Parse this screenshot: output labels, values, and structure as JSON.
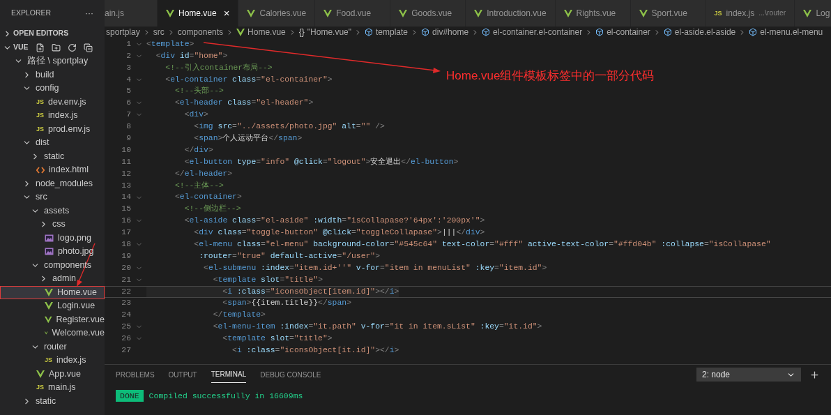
{
  "sidebar": {
    "title": "EXPLORER",
    "more": "···",
    "sections": [
      {
        "label": "OPEN EDITORS",
        "expanded": false
      },
      {
        "label": "VUE",
        "expanded": true
      }
    ],
    "tree": [
      {
        "kind": "folder",
        "label": "路径 \\ sportplay",
        "expanded": true,
        "selected": false,
        "children": [
          {
            "kind": "folder",
            "label": "build",
            "expanded": false,
            "selected": false
          },
          {
            "kind": "folder",
            "label": "config",
            "expanded": true,
            "selected": false,
            "children": [
              {
                "kind": "js",
                "icon": "JS",
                "label": "dev.env.js",
                "selected": false
              },
              {
                "kind": "js",
                "icon": "JS",
                "label": "index.js",
                "selected": false
              },
              {
                "kind": "js",
                "icon": "JS",
                "label": "prod.env.js",
                "selected": false
              }
            ]
          },
          {
            "kind": "folder",
            "label": "dist",
            "expanded": true,
            "selected": false,
            "children": [
              {
                "kind": "folder",
                "label": "static",
                "expanded": false,
                "selected": false
              },
              {
                "kind": "html",
                "label": "index.html",
                "selected": false
              }
            ]
          },
          {
            "kind": "folder",
            "label": "node_modules",
            "expanded": false,
            "selected": false
          },
          {
            "kind": "folder",
            "label": "src",
            "expanded": true,
            "selected": false,
            "children": [
              {
                "kind": "folder",
                "label": "assets",
                "expanded": true,
                "selected": false,
                "children": [
                  {
                    "kind": "folder",
                    "label": "css",
                    "expanded": false,
                    "selected": false
                  },
                  {
                    "kind": "image",
                    "label": "logo.png",
                    "selected": false
                  },
                  {
                    "kind": "image",
                    "label": "photo.jpg",
                    "selected": false
                  }
                ]
              },
              {
                "kind": "folder",
                "label": "components",
                "expanded": true,
                "selected": false,
                "children": [
                  {
                    "kind": "folder",
                    "label": "admin",
                    "expanded": false,
                    "selected": false
                  },
                  {
                    "kind": "vue",
                    "label": "Home.vue",
                    "selected": true
                  },
                  {
                    "kind": "vue",
                    "label": "Login.vue",
                    "selected": false
                  },
                  {
                    "kind": "vue",
                    "label": "Register.vue",
                    "selected": false
                  },
                  {
                    "kind": "vue",
                    "label": "Welcome.vue",
                    "selected": false
                  }
                ]
              },
              {
                "kind": "folder",
                "label": "router",
                "expanded": true,
                "selected": false,
                "children": [
                  {
                    "kind": "js",
                    "icon": "JS",
                    "label": "index.js",
                    "selected": false
                  }
                ]
              },
              {
                "kind": "vue",
                "label": "App.vue",
                "selected": false
              },
              {
                "kind": "js",
                "icon": "JS",
                "label": "main.js",
                "selected": false
              }
            ]
          },
          {
            "kind": "folder",
            "label": "static",
            "expanded": false,
            "selected": false
          }
        ]
      }
    ]
  },
  "tabs": [
    {
      "label": "ain.js",
      "selected": false
    },
    {
      "kind": "vue",
      "label": "Home.vue",
      "selected": true,
      "close": "×"
    },
    {
      "kind": "vue",
      "label": "Calories.vue",
      "selected": false
    },
    {
      "kind": "vue",
      "label": "Food.vue",
      "selected": false
    },
    {
      "kind": "vue",
      "label": "Goods.vue",
      "selected": false
    },
    {
      "kind": "vue",
      "label": "Introduction.vue",
      "selected": false
    },
    {
      "kind": "vue",
      "label": "Rights.vue",
      "selected": false
    },
    {
      "kind": "vue",
      "label": "Sport.vue",
      "selected": false
    },
    {
      "kind": "js",
      "icon": "JS",
      "label": "index.js",
      "hint": "...\\router",
      "selected": false
    },
    {
      "kind": "vue",
      "label": "Log",
      "selected": false
    }
  ],
  "breadcrumbs": [
    {
      "kind": "folder",
      "label": "sportplay"
    },
    {
      "kind": "folder",
      "label": "src"
    },
    {
      "kind": "folder",
      "label": "components"
    },
    {
      "kind": "vue",
      "label": "Home.vue"
    },
    {
      "kind": "object",
      "icon": "{}",
      "label": "\"Home.vue\""
    },
    {
      "kind": "element",
      "label": "template"
    },
    {
      "kind": "element",
      "label": "div#home"
    },
    {
      "kind": "element",
      "label": "el-container.el-container"
    },
    {
      "kind": "element",
      "label": "el-container"
    },
    {
      "kind": "element",
      "label": "el-aside.el-aside"
    },
    {
      "kind": "element",
      "label": "el-menu.el-menu"
    }
  ],
  "code": [
    {
      "n": "1",
      "fold": true,
      "current": false,
      "tokens": [
        {
          "kind": "p",
          "text": "<"
        },
        {
          "kind": "t",
          "text": "template"
        },
        {
          "kind": "p",
          "text": ">"
        }
      ]
    },
    {
      "n": "2",
      "fold": true,
      "current": false,
      "tokens": [
        {
          "kind": "p",
          "text": "  <"
        },
        {
          "kind": "t",
          "text": "div"
        },
        {
          "kind": "a",
          "text": " id"
        },
        {
          "kind": "p",
          "text": "="
        },
        {
          "kind": "s",
          "text": "\"home\""
        },
        {
          "kind": "p",
          "text": ">"
        }
      ]
    },
    {
      "n": "3",
      "fold": false,
      "current": false,
      "tokens": [
        {
          "kind": "c",
          "text": "    <!--引入container布局-->"
        }
      ]
    },
    {
      "n": "4",
      "fold": true,
      "current": false,
      "tokens": [
        {
          "kind": "p",
          "text": "    <"
        },
        {
          "kind": "t",
          "text": "el-container"
        },
        {
          "kind": "a",
          "text": " class"
        },
        {
          "kind": "p",
          "text": "="
        },
        {
          "kind": "s",
          "text": "\"el-container\""
        },
        {
          "kind": "p",
          "text": ">"
        }
      ]
    },
    {
      "n": "5",
      "fold": false,
      "current": false,
      "tokens": [
        {
          "kind": "c",
          "text": "      <!--头部-->"
        }
      ]
    },
    {
      "n": "6",
      "fold": true,
      "current": false,
      "tokens": [
        {
          "kind": "p",
          "text": "      <"
        },
        {
          "kind": "t",
          "text": "el-header"
        },
        {
          "kind": "a",
          "text": " class"
        },
        {
          "kind": "p",
          "text": "="
        },
        {
          "kind": "s",
          "text": "\"el-header\""
        },
        {
          "kind": "p",
          "text": ">"
        }
      ]
    },
    {
      "n": "7",
      "fold": true,
      "current": false,
      "tokens": [
        {
          "kind": "p",
          "text": "        <"
        },
        {
          "kind": "t",
          "text": "div"
        },
        {
          "kind": "p",
          "text": ">"
        }
      ]
    },
    {
      "n": "8",
      "fold": false,
      "current": false,
      "tokens": [
        {
          "kind": "p",
          "text": "          <"
        },
        {
          "kind": "t",
          "text": "img"
        },
        {
          "kind": "a",
          "text": " src"
        },
        {
          "kind": "p",
          "text": "="
        },
        {
          "kind": "s",
          "text": "\"../assets/photo.jpg\""
        },
        {
          "kind": "a",
          "text": " alt"
        },
        {
          "kind": "p",
          "text": "="
        },
        {
          "kind": "s",
          "text": "\"\""
        },
        {
          "kind": "p",
          "text": " />"
        }
      ]
    },
    {
      "n": "9",
      "fold": false,
      "current": false,
      "tokens": [
        {
          "kind": "p",
          "text": "          <"
        },
        {
          "kind": "t",
          "text": "span"
        },
        {
          "kind": "p",
          "text": ">"
        },
        {
          "kind": "x",
          "text": "个人运动平台"
        },
        {
          "kind": "p",
          "text": "</"
        },
        {
          "kind": "t",
          "text": "span"
        },
        {
          "kind": "p",
          "text": ">"
        }
      ]
    },
    {
      "n": "10",
      "fold": false,
      "current": false,
      "tokens": [
        {
          "kind": "p",
          "text": "        </"
        },
        {
          "kind": "t",
          "text": "div"
        },
        {
          "kind": "p",
          "text": ">"
        }
      ]
    },
    {
      "n": "11",
      "fold": false,
      "current": false,
      "tokens": [
        {
          "kind": "p",
          "text": "        <"
        },
        {
          "kind": "t",
          "text": "el-button"
        },
        {
          "kind": "a",
          "text": " type"
        },
        {
          "kind": "p",
          "text": "="
        },
        {
          "kind": "s",
          "text": "\"info\""
        },
        {
          "kind": "a",
          "text": " @click"
        },
        {
          "kind": "p",
          "text": "="
        },
        {
          "kind": "s",
          "text": "\"logout\""
        },
        {
          "kind": "p",
          "text": ">"
        },
        {
          "kind": "x",
          "text": "安全退出"
        },
        {
          "kind": "p",
          "text": "</"
        },
        {
          "kind": "t",
          "text": "el-button"
        },
        {
          "kind": "p",
          "text": ">"
        }
      ]
    },
    {
      "n": "12",
      "fold": false,
      "current": false,
      "tokens": [
        {
          "kind": "p",
          "text": "      </"
        },
        {
          "kind": "t",
          "text": "el-header"
        },
        {
          "kind": "p",
          "text": ">"
        }
      ]
    },
    {
      "n": "13",
      "fold": false,
      "current": false,
      "tokens": [
        {
          "kind": "c",
          "text": "      <!--主体-->"
        }
      ]
    },
    {
      "n": "14",
      "fold": true,
      "current": false,
      "tokens": [
        {
          "kind": "p",
          "text": "      <"
        },
        {
          "kind": "t",
          "text": "el-container"
        },
        {
          "kind": "p",
          "text": ">"
        }
      ]
    },
    {
      "n": "15",
      "fold": false,
      "current": false,
      "tokens": [
        {
          "kind": "c",
          "text": "        <!--侧边栏-->"
        }
      ]
    },
    {
      "n": "16",
      "fold": true,
      "current": false,
      "tokens": [
        {
          "kind": "p",
          "text": "        <"
        },
        {
          "kind": "t",
          "text": "el-aside"
        },
        {
          "kind": "a",
          "text": " class"
        },
        {
          "kind": "p",
          "text": "="
        },
        {
          "kind": "s",
          "text": "\"el-aside\""
        },
        {
          "kind": "a",
          "text": " :width"
        },
        {
          "kind": "p",
          "text": "="
        },
        {
          "kind": "s",
          "text": "\"isCollapase?'64px':'200px'\""
        },
        {
          "kind": "p",
          "text": ">"
        }
      ]
    },
    {
      "n": "17",
      "fold": false,
      "current": false,
      "tokens": [
        {
          "kind": "p",
          "text": "          <"
        },
        {
          "kind": "t",
          "text": "div"
        },
        {
          "kind": "a",
          "text": " class"
        },
        {
          "kind": "p",
          "text": "="
        },
        {
          "kind": "s",
          "text": "\"toggle-button\""
        },
        {
          "kind": "a",
          "text": " @click"
        },
        {
          "kind": "p",
          "text": "="
        },
        {
          "kind": "s",
          "text": "\"toggleCollapase\""
        },
        {
          "kind": "p",
          "text": ">"
        },
        {
          "kind": "x",
          "text": "|||"
        },
        {
          "kind": "p",
          "text": "</"
        },
        {
          "kind": "t",
          "text": "div"
        },
        {
          "kind": "p",
          "text": ">"
        }
      ]
    },
    {
      "n": "18",
      "fold": true,
      "current": false,
      "tokens": [
        {
          "kind": "p",
          "text": "          <"
        },
        {
          "kind": "t",
          "text": "el-menu"
        },
        {
          "kind": "a",
          "text": " class"
        },
        {
          "kind": "p",
          "text": "="
        },
        {
          "kind": "s",
          "text": "\"el-menu\""
        },
        {
          "kind": "a",
          "text": " background-color"
        },
        {
          "kind": "p",
          "text": "="
        },
        {
          "kind": "s",
          "text": "\"#545c64\""
        },
        {
          "kind": "a",
          "text": " text-color"
        },
        {
          "kind": "p",
          "text": "="
        },
        {
          "kind": "s",
          "text": "\"#fff\""
        },
        {
          "kind": "a",
          "text": " active-text-color"
        },
        {
          "kind": "p",
          "text": "="
        },
        {
          "kind": "s",
          "text": "\"#ffd04b\""
        },
        {
          "kind": "a",
          "text": " :collapse"
        },
        {
          "kind": "p",
          "text": "="
        },
        {
          "kind": "s",
          "text": "\"isCollapase\""
        }
      ]
    },
    {
      "n": "19",
      "fold": false,
      "current": false,
      "tokens": [
        {
          "kind": "a",
          "text": "           :router"
        },
        {
          "kind": "p",
          "text": "="
        },
        {
          "kind": "s",
          "text": "\"true\""
        },
        {
          "kind": "a",
          "text": " default-active"
        },
        {
          "kind": "p",
          "text": "="
        },
        {
          "kind": "s",
          "text": "\"/user\""
        },
        {
          "kind": "p",
          "text": ">"
        }
      ]
    },
    {
      "n": "20",
      "fold": true,
      "current": false,
      "tokens": [
        {
          "kind": "p",
          "text": "            <"
        },
        {
          "kind": "t",
          "text": "el-submenu"
        },
        {
          "kind": "a",
          "text": " :index"
        },
        {
          "kind": "p",
          "text": "="
        },
        {
          "kind": "s",
          "text": "\"item.id+''\""
        },
        {
          "kind": "a",
          "text": " v-for"
        },
        {
          "kind": "p",
          "text": "="
        },
        {
          "kind": "s",
          "text": "\"item in menuList\""
        },
        {
          "kind": "a",
          "text": " :key"
        },
        {
          "kind": "p",
          "text": "="
        },
        {
          "kind": "s",
          "text": "\"item.id\""
        },
        {
          "kind": "p",
          "text": ">"
        }
      ]
    },
    {
      "n": "21",
      "fold": true,
      "current": false,
      "tokens": [
        {
          "kind": "p",
          "text": "              <"
        },
        {
          "kind": "t",
          "text": "template"
        },
        {
          "kind": "a",
          "text": " slot"
        },
        {
          "kind": "p",
          "text": "="
        },
        {
          "kind": "s",
          "text": "\"title\""
        },
        {
          "kind": "p",
          "text": ">"
        }
      ]
    },
    {
      "n": "22",
      "fold": false,
      "current": true,
      "tokens": [
        {
          "kind": "p",
          "text": "                <"
        },
        {
          "kind": "t",
          "text": "i"
        },
        {
          "kind": "a",
          "text": " :class"
        },
        {
          "kind": "p",
          "text": "="
        },
        {
          "kind": "s",
          "text": "\"iconsObject[item.id]\""
        },
        {
          "kind": "p",
          "text": "></"
        },
        {
          "kind": "t",
          "text": "i"
        },
        {
          "kind": "p",
          "text": ">"
        }
      ]
    },
    {
      "n": "23",
      "fold": false,
      "current": false,
      "tokens": [
        {
          "kind": "p",
          "text": "                <"
        },
        {
          "kind": "t",
          "text": "span"
        },
        {
          "kind": "p",
          "text": ">"
        },
        {
          "kind": "x",
          "text": "{{item.title}}"
        },
        {
          "kind": "p",
          "text": "</"
        },
        {
          "kind": "t",
          "text": "span"
        },
        {
          "kind": "p",
          "text": ">"
        }
      ]
    },
    {
      "n": "24",
      "fold": false,
      "current": false,
      "tokens": [
        {
          "kind": "p",
          "text": "              </"
        },
        {
          "kind": "t",
          "text": "template"
        },
        {
          "kind": "p",
          "text": ">"
        }
      ]
    },
    {
      "n": "25",
      "fold": true,
      "current": false,
      "tokens": [
        {
          "kind": "p",
          "text": "              <"
        },
        {
          "kind": "t",
          "text": "el-menu-item"
        },
        {
          "kind": "a",
          "text": " :index"
        },
        {
          "kind": "p",
          "text": "="
        },
        {
          "kind": "s",
          "text": "\"it.path\""
        },
        {
          "kind": "a",
          "text": " v-for"
        },
        {
          "kind": "p",
          "text": "="
        },
        {
          "kind": "s",
          "text": "\"it in item.sList\""
        },
        {
          "kind": "a",
          "text": " :key"
        },
        {
          "kind": "p",
          "text": "="
        },
        {
          "kind": "s",
          "text": "\"it.id\""
        },
        {
          "kind": "p",
          "text": ">"
        }
      ]
    },
    {
      "n": "26",
      "fold": true,
      "current": false,
      "tokens": [
        {
          "kind": "p",
          "text": "                <"
        },
        {
          "kind": "t",
          "text": "template"
        },
        {
          "kind": "a",
          "text": " slot"
        },
        {
          "kind": "p",
          "text": "="
        },
        {
          "kind": "s",
          "text": "\"title\""
        },
        {
          "kind": "p",
          "text": ">"
        }
      ]
    },
    {
      "n": "27",
      "fold": false,
      "current": false,
      "tokens": [
        {
          "kind": "p",
          "text": "                  <"
        },
        {
          "kind": "t",
          "text": "i"
        },
        {
          "kind": "a",
          "text": " :class"
        },
        {
          "kind": "p",
          "text": "="
        },
        {
          "kind": "s",
          "text": "\"iconsObject[it.id]\""
        },
        {
          "kind": "p",
          "text": "></"
        },
        {
          "kind": "t",
          "text": "i"
        },
        {
          "kind": "p",
          "text": ">"
        }
      ]
    }
  ],
  "annotation": {
    "text": "Home.vue组件模板标签中的一部分代码"
  },
  "panel": {
    "tabs": [
      {
        "label": "PROBLEMS",
        "selected": false
      },
      {
        "label": "OUTPUT",
        "selected": false
      },
      {
        "label": "TERMINAL",
        "selected": true
      },
      {
        "label": "DEBUG CONSOLE",
        "selected": false
      }
    ],
    "terminal_select": "2: node",
    "output": [
      {
        "badge": "DONE",
        "text": "Compiled successfully in 16609ms"
      }
    ]
  }
}
